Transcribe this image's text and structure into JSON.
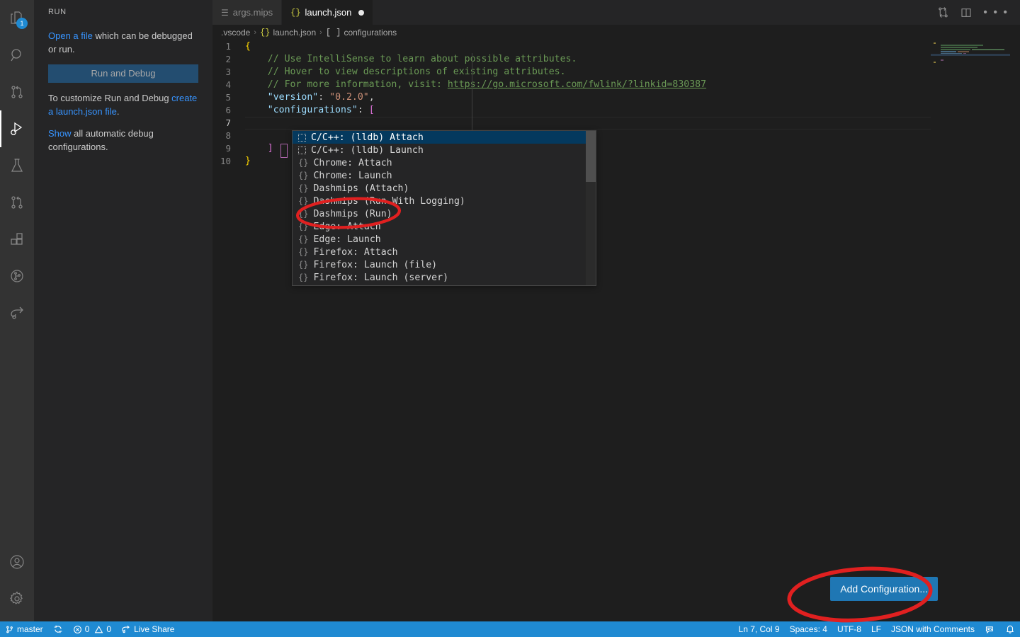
{
  "app": {
    "theme_bg": "#1e1e1e",
    "accent": "#1f8ad2",
    "annotation_color": "#e02020"
  },
  "activity_bar": {
    "items": [
      {
        "name": "explorer",
        "icon": "files-icon",
        "badge": "1",
        "active": false
      },
      {
        "name": "search",
        "icon": "search-icon",
        "badge": "",
        "active": false
      },
      {
        "name": "source-control",
        "icon": "source-control-icon",
        "badge": "",
        "active": false
      },
      {
        "name": "run-and-debug",
        "icon": "run-debug-icon",
        "badge": "",
        "active": true
      },
      {
        "name": "testing",
        "icon": "beaker-icon",
        "badge": "",
        "active": false
      },
      {
        "name": "pull-requests",
        "icon": "git-pull-request-icon",
        "badge": "",
        "active": false
      },
      {
        "name": "extensions",
        "icon": "extensions-icon",
        "badge": "",
        "active": false
      },
      {
        "name": "timeline",
        "icon": "circle-branch-icon",
        "badge": "",
        "active": false
      },
      {
        "name": "live-share",
        "icon": "live-share-icon",
        "badge": "",
        "active": false
      }
    ],
    "bottom_items": [
      {
        "name": "accounts",
        "icon": "account-icon"
      },
      {
        "name": "manage-settings",
        "icon": "gear-icon"
      }
    ]
  },
  "sidebar": {
    "title": "RUN",
    "open_file_link": "Open a file",
    "open_file_rest": " which can be debugged or run.",
    "run_and_debug_button": "Run and Debug",
    "customize_prefix": "To customize Run and Debug ",
    "customize_link": "create a launch.json file",
    "customize_suffix": ".",
    "show_link": "Show",
    "show_rest": " all automatic debug configurations."
  },
  "tabs": [
    {
      "label": "args.mips",
      "icon": "mips-file-icon",
      "glyph": "☰",
      "active": false,
      "dirty": false
    },
    {
      "label": "launch.json",
      "icon": "json-file-icon",
      "glyph": "{}",
      "active": true,
      "dirty": true
    }
  ],
  "tab_actions": [
    {
      "name": "split-editor-reverse-icon"
    },
    {
      "name": "split-editor-icon"
    },
    {
      "name": "more-actions-icon",
      "glyph": "• • •"
    }
  ],
  "breadcrumbs": [
    {
      "label": ".vscode",
      "icon": ""
    },
    {
      "label": "launch.json",
      "icon": "{}"
    },
    {
      "label": "configurations",
      "icon": "[ ]"
    }
  ],
  "editor": {
    "filename": "launch.json",
    "lines": [
      {
        "n": "1",
        "tokens": [
          {
            "t": "{",
            "c": "tok-brace-y"
          }
        ]
      },
      {
        "n": "2",
        "tokens": [
          {
            "t": "    // Use IntelliSense to learn about possible attributes.",
            "c": "tok-comment"
          }
        ]
      },
      {
        "n": "3",
        "tokens": [
          {
            "t": "    // Hover to view descriptions of existing attributes.",
            "c": "tok-comment"
          }
        ]
      },
      {
        "n": "4",
        "tokens": [
          {
            "t": "    // For more information, visit: ",
            "c": "tok-comment"
          },
          {
            "t": "https://go.microsoft.com/fwlink/?linkid=830387",
            "c": "tok-link"
          }
        ]
      },
      {
        "n": "5",
        "tokens": [
          {
            "t": "    ",
            "c": "tok-punc"
          },
          {
            "t": "\"version\"",
            "c": "tok-key"
          },
          {
            "t": ": ",
            "c": "tok-punc"
          },
          {
            "t": "\"0.2.0\"",
            "c": "tok-str"
          },
          {
            "t": ",",
            "c": "tok-punc"
          }
        ]
      },
      {
        "n": "6",
        "tokens": [
          {
            "t": "    ",
            "c": "tok-punc"
          },
          {
            "t": "\"configurations\"",
            "c": "tok-key"
          },
          {
            "t": ": ",
            "c": "tok-punc"
          },
          {
            "t": "[",
            "c": "tok-brace-p"
          }
        ]
      },
      {
        "n": "7",
        "tokens": [
          {
            "t": "        ",
            "c": "tok-punc"
          }
        ],
        "current": true
      },
      {
        "n": "8",
        "tokens": [
          {
            "t": "    ",
            "c": "tok-punc"
          }
        ]
      },
      {
        "n": "9",
        "tokens": [
          {
            "t": "    ",
            "c": "tok-punc"
          },
          {
            "t": "]",
            "c": "tok-brace-p"
          }
        ]
      },
      {
        "n": "10",
        "tokens": [
          {
            "t": "}",
            "c": "tok-brace-y"
          }
        ]
      }
    ]
  },
  "suggestions": {
    "selected_index": 0,
    "items": [
      {
        "label": "C/C++: (lldb) Attach",
        "icon": "snippet-box-icon"
      },
      {
        "label": "C/C++: (lldb) Launch",
        "icon": "snippet-box-icon"
      },
      {
        "label": "Chrome: Attach",
        "icon": "module-braces-icon"
      },
      {
        "label": "Chrome: Launch",
        "icon": "module-braces-icon"
      },
      {
        "label": "Dashmips (Attach)",
        "icon": "module-braces-icon"
      },
      {
        "label": "Dashmips (Run With Logging)",
        "icon": "module-braces-icon"
      },
      {
        "label": "Dashmips (Run)",
        "icon": "module-braces-icon"
      },
      {
        "label": "Edge: Attach",
        "icon": "module-braces-icon"
      },
      {
        "label": "Edge: Launch",
        "icon": "module-braces-icon"
      },
      {
        "label": "Firefox: Attach",
        "icon": "module-braces-icon"
      },
      {
        "label": "Firefox: Launch (file)",
        "icon": "module-braces-icon"
      },
      {
        "label": "Firefox: Launch (server)",
        "icon": "module-braces-icon"
      }
    ]
  },
  "add_configuration_button": "Add Configuration...",
  "status_bar": {
    "left": [
      {
        "name": "remote-sync-branch",
        "icon": "source-control-icon",
        "label": "master"
      },
      {
        "name": "sync-changes",
        "icon": "sync-icon",
        "label": ""
      },
      {
        "name": "problems",
        "icon": "error-warning-icon",
        "label": "0  0",
        "errors": "0",
        "warnings": "0"
      },
      {
        "name": "live-share",
        "icon": "live-share-icon",
        "label": "Live Share"
      }
    ],
    "right": [
      {
        "name": "editor-position",
        "label": "Ln 7, Col 9"
      },
      {
        "name": "indentation",
        "label": "Spaces: 4"
      },
      {
        "name": "encoding",
        "label": "UTF-8"
      },
      {
        "name": "eol",
        "label": "LF"
      },
      {
        "name": "language-mode",
        "label": "JSON with Comments"
      },
      {
        "name": "feedback-icon",
        "label": ""
      },
      {
        "name": "notifications-bell-icon",
        "label": ""
      }
    ]
  },
  "annotations": [
    {
      "name": "highlight-dashmips-run",
      "shape": "ellipse"
    },
    {
      "name": "highlight-add-configuration",
      "shape": "ellipse"
    }
  ]
}
